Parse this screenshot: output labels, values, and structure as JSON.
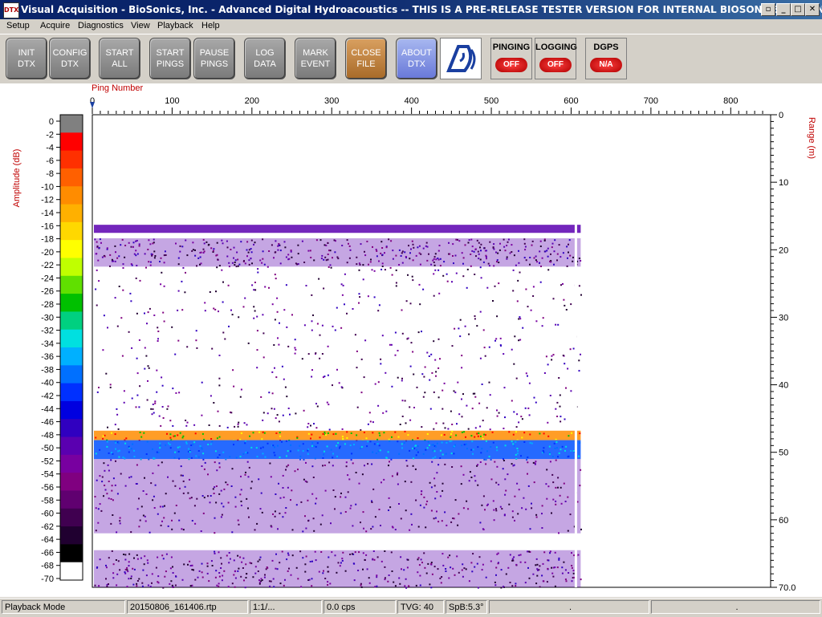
{
  "window": {
    "icon_text": "DTX",
    "title": "Visual Acquisition  -  BioSonics, Inc.  -  Advanced Digital Hydroacoustics  -- THIS IS A PRE-RELEASE TESTER VERSION FOR INTERNAL BIOSONICS USE ONLY",
    "controls": [
      "restore-icon",
      "minimize-icon",
      "maximize-icon",
      "close-icon"
    ]
  },
  "menu": [
    "Setup",
    "Acquire",
    "Diagnostics",
    "View",
    "Playback",
    "Help"
  ],
  "toolbar": {
    "buttons": [
      {
        "label": "INIT\nDTX",
        "style": "gray"
      },
      {
        "label": "CONFIG\nDTX",
        "style": "gray"
      },
      {
        "label": "START\nALL",
        "style": "gray"
      },
      {
        "label": "START\nPINGS",
        "style": "gray"
      },
      {
        "label": "PAUSE\nPINGS",
        "style": "gray"
      },
      {
        "label": "LOG\nDATA",
        "style": "gray"
      },
      {
        "label": "MARK\nEVENT",
        "style": "gray"
      },
      {
        "label": "CLOSE\nFILE",
        "style": "orange"
      },
      {
        "label": "ABOUT\nDTX",
        "style": "blue"
      }
    ],
    "indicators": [
      {
        "label": "PINGING",
        "state": "OFF"
      },
      {
        "label": "LOGGING",
        "state": "OFF"
      },
      {
        "label": "DGPS",
        "state": "N/A"
      }
    ]
  },
  "echogram": {
    "ping_axis_label": "Ping Number",
    "ping_ticks": [
      "0",
      "100",
      "200",
      "300",
      "400",
      "500",
      "600",
      "700",
      "800"
    ],
    "ping_max": 850,
    "pings_recorded": 612,
    "amplitude_label": "Amplitude (dB)",
    "amplitude_ticks": [
      "0",
      "-2",
      "-4",
      "-6",
      "-8",
      "-10",
      "-12",
      "-14",
      "-16",
      "-18",
      "-20",
      "-22",
      "-24",
      "-26",
      "-28",
      "-30",
      "-32",
      "-34",
      "-36",
      "-38",
      "-40",
      "-42",
      "-44",
      "-46",
      "-48",
      "-50",
      "-52",
      "-54",
      "-56",
      "-58",
      "-60",
      "-62",
      "-64",
      "-66",
      "-68",
      "-70"
    ],
    "range_label": "Range (m)",
    "range_ticks": [
      "0",
      "10",
      "20",
      "30",
      "40",
      "50",
      "60",
      "70.0"
    ],
    "range_max": 70,
    "colorscale": [
      "#808080",
      "#ff0000",
      "#ff3000",
      "#ff6000",
      "#ff8c00",
      "#ffb000",
      "#ffd800",
      "#ffff00",
      "#c0ff00",
      "#60e000",
      "#00c000",
      "#00d080",
      "#00e0e0",
      "#00b0ff",
      "#0070ff",
      "#0030ff",
      "#0000e0",
      "#3000c0",
      "#5a00b0",
      "#7800a0",
      "#800080",
      "#600070",
      "#400050",
      "#200030",
      "#000000",
      "#ffffff"
    ],
    "layers": [
      {
        "from_m": 16.3,
        "to_m": 17.5,
        "kind": "thin-band"
      },
      {
        "from_m": 18.3,
        "to_m": 22.5,
        "kind": "dense-scatter"
      },
      {
        "from_m": 22.5,
        "to_m": 46.8,
        "kind": "sparse-scatter"
      },
      {
        "from_m": 46.8,
        "to_m": 48.2,
        "kind": "bottom-peak"
      },
      {
        "from_m": 48.2,
        "to_m": 51.0,
        "kind": "strong-return"
      },
      {
        "from_m": 51.0,
        "to_m": 62.0,
        "kind": "dense-scatter"
      },
      {
        "from_m": 64.5,
        "to_m": 70.0,
        "kind": "dense-scatter"
      }
    ]
  },
  "status": [
    "Playback Mode",
    "20150806_161406.rtp",
    "1:1/...",
    "0.0 cps",
    "TVG: 40",
    "SpB:5.3°",
    ".",
    "."
  ]
}
